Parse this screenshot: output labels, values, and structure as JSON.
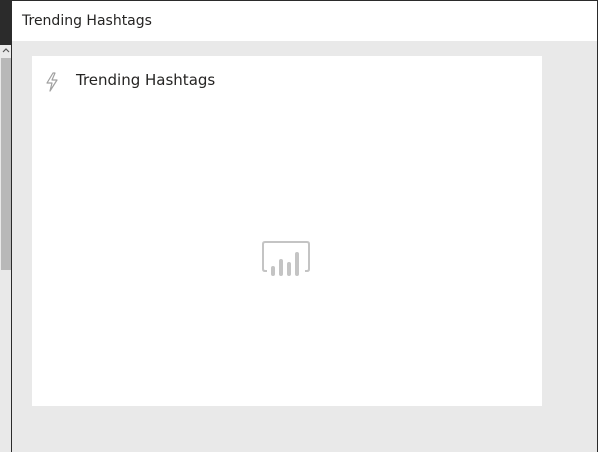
{
  "window": {
    "title": "Trending Hashtags"
  },
  "tile": {
    "title": "Trending Hashtags",
    "icon": "lightning-bolt-icon",
    "placeholder_icon": "bar-chart-placeholder-icon"
  },
  "colors": {
    "background": "#e9e9e9",
    "card": "#ffffff",
    "text": "#252423",
    "icon": "#a0a0a0",
    "frame": "#2b2b2b"
  }
}
